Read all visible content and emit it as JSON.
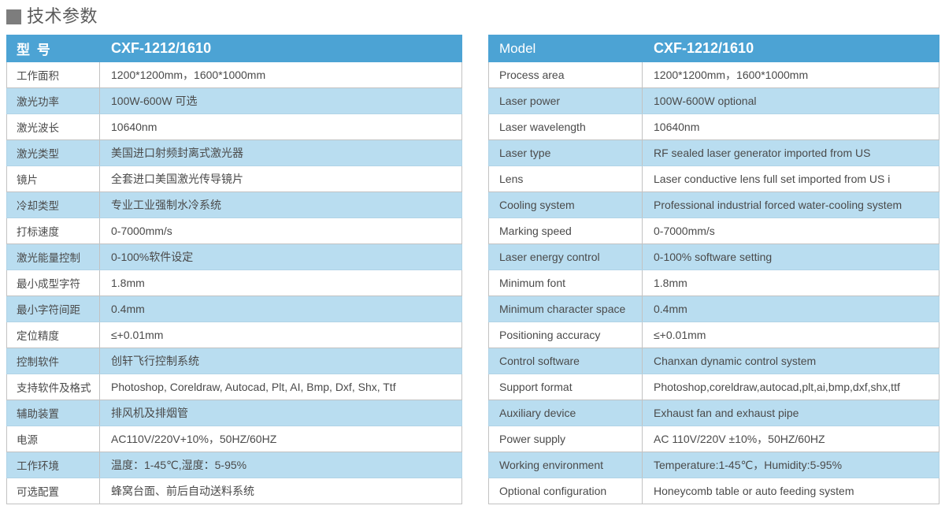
{
  "title": {
    "marker": "square-bullet",
    "text": "技术参数"
  },
  "tables": [
    {
      "id": "cn",
      "header": {
        "label": "型  号",
        "value": "CXF-1212/1610"
      },
      "rows": [
        {
          "label": "工作面积",
          "value": "1200*1200mm，1600*1000mm"
        },
        {
          "label": "激光功率",
          "value": "100W-600W 可选"
        },
        {
          "label": "激光波长",
          "value": "10640nm"
        },
        {
          "label": "激光类型",
          "value": "美国进口射频封离式激光器"
        },
        {
          "label": "镜片",
          "value": "全套进口美国激光传导镜片"
        },
        {
          "label": "冷却类型",
          "value": "专业工业强制水冷系统"
        },
        {
          "label": "打标速度",
          "value": "0-7000mm/s"
        },
        {
          "label": "激光能量控制",
          "value": "0-100%软件设定"
        },
        {
          "label": "最小成型字符",
          "value": "1.8mm"
        },
        {
          "label": "最小字符间距",
          "value": "0.4mm"
        },
        {
          "label": "定位精度",
          "value": "≤+0.01mm"
        },
        {
          "label": "控制软件",
          "value": "创轩飞行控制系统"
        },
        {
          "label": "支持软件及格式",
          "value": "Photoshop, Coreldraw, Autocad, Plt, AI, Bmp, Dxf, Shx, Ttf"
        },
        {
          "label": "辅助装置",
          "value": "排风机及排烟管"
        },
        {
          "label": "电源",
          "value": "AC110V/220V+10%，50HZ/60HZ"
        },
        {
          "label": "工作环境",
          "value": "温度：1-45℃,湿度：5-95%"
        },
        {
          "label": "可选配置",
          "value": "蜂窝台面、前后自动送料系统"
        }
      ]
    },
    {
      "id": "en",
      "header": {
        "label": "Model",
        "value": "CXF-1212/1610"
      },
      "rows": [
        {
          "label": "Process area",
          "value": "1200*1200mm，1600*1000mm"
        },
        {
          "label": "Laser power",
          "value": "100W-600W optional"
        },
        {
          "label": "Laser wavelength",
          "value": "10640nm"
        },
        {
          "label": "Laser type",
          "value": "RF sealed laser generator imported from US"
        },
        {
          "label": "Lens",
          "value": "Laser conductive lens full set imported from US i"
        },
        {
          "label": "Cooling system",
          "value": "Professional industrial forced water-cooling system"
        },
        {
          "label": "Marking speed",
          "value": "0-7000mm/s"
        },
        {
          "label": "Laser energy control",
          "value": "0-100% software setting"
        },
        {
          "label": "Minimum  font",
          "value": "1.8mm"
        },
        {
          "label": "Minimum character space",
          "value": "0.4mm"
        },
        {
          "label": "Positioning accuracy",
          "value": "≤+0.01mm"
        },
        {
          "label": "Control software",
          "value": "Chanxan dynamic control system"
        },
        {
          "label": "Support format",
          "value": "Photoshop,coreldraw,autocad,plt,ai,bmp,dxf,shx,ttf"
        },
        {
          "label": "Auxiliary device",
          "value": "Exhaust fan and exhaust pipe"
        },
        {
          "label": "Power supply",
          "value": "AC 110V/220V ±10%，50HZ/60HZ"
        },
        {
          "label": "Working environment",
          "value": "Temperature:1-45℃，Humidity:5-95%"
        },
        {
          "label": "Optional configuration",
          "value": "Honeycomb table or auto feeding system"
        }
      ]
    }
  ],
  "colors": {
    "header_blue": "#4ca3d4",
    "alt_row_blue": "#b9ddf0",
    "border_gray": "#c2c2c2",
    "text_gray": "#4a4a4a",
    "marker_gray": "#7d7d7d"
  }
}
